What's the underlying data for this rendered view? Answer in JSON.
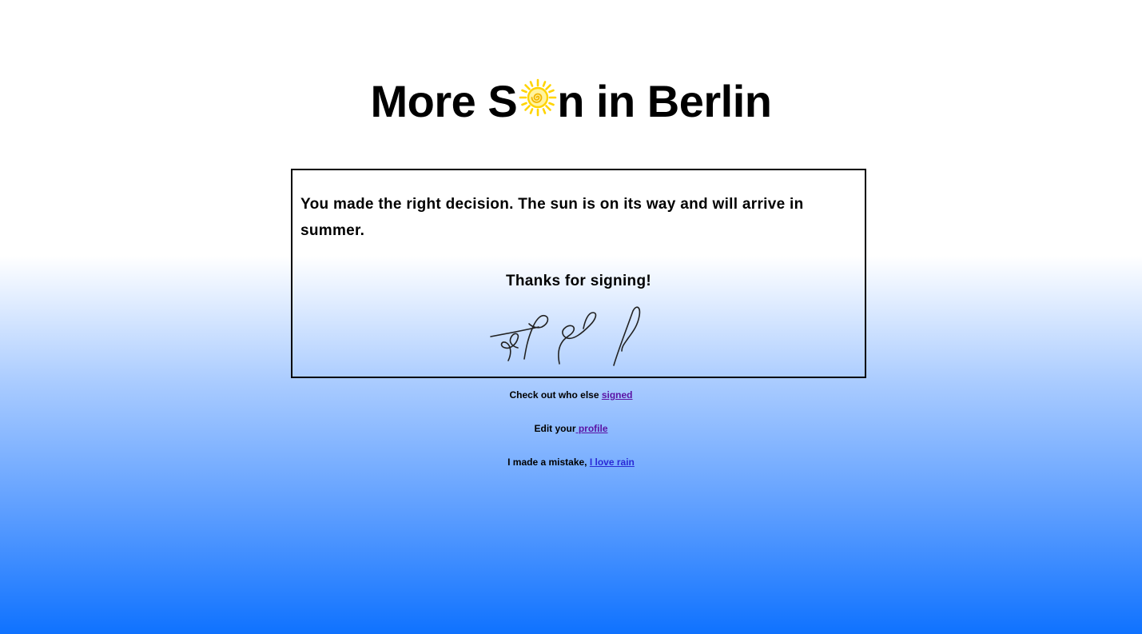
{
  "header": {
    "title_before": "More S",
    "title_after": "n in Berlin",
    "sun_icon": "sun-icon",
    "sun_color": "#ffd400"
  },
  "card": {
    "message": "You made the right decision. The sun is on its way and will arrive in summer.",
    "thanks": "Thanks for signing!"
  },
  "links": {
    "signed_prefix": "Check out who else ",
    "signed_label": "signed",
    "profile_prefix": "Edit your",
    "profile_label": " profile",
    "mistake_prefix": "I made a mistake, ",
    "rain_label": "I love rain"
  },
  "colors": {
    "link_visited": "#5b13a4",
    "link": "#2a2ad6",
    "gradient_bottom": "#0f72ff"
  }
}
